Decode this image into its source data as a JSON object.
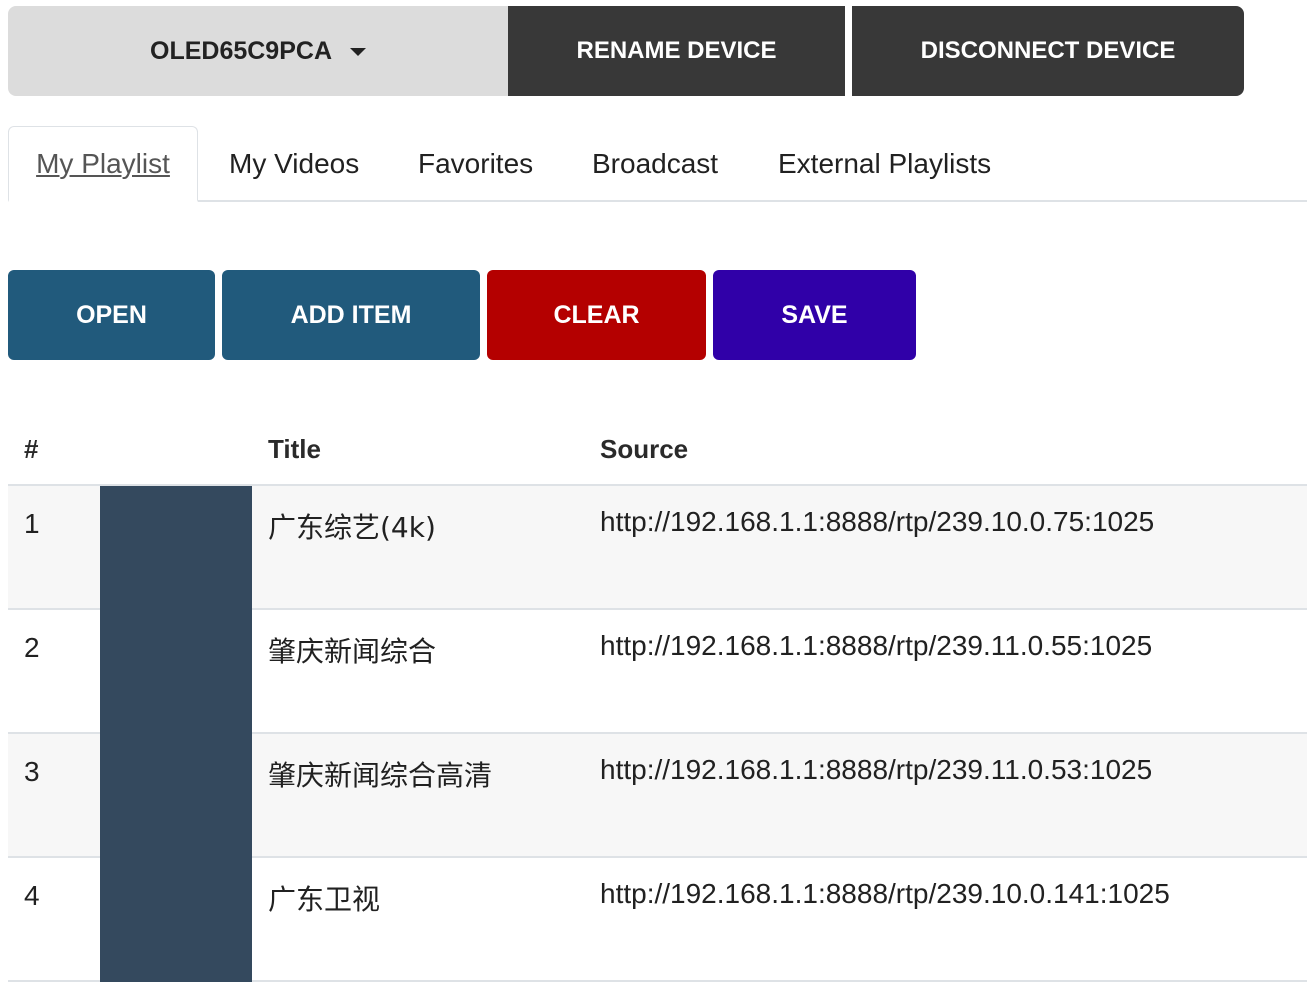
{
  "device_bar": {
    "device_name": "OLED65C9PCA",
    "rename_label": "RENAME DEVICE",
    "disconnect_label": "DISCONNECT DEVICE"
  },
  "tabs": [
    {
      "label": "My Playlist",
      "active": true
    },
    {
      "label": "My Videos",
      "active": false
    },
    {
      "label": "Favorites",
      "active": false
    },
    {
      "label": "Broadcast",
      "active": false
    },
    {
      "label": "External Playlists",
      "active": false
    }
  ],
  "actions": {
    "open_label": "OPEN",
    "add_item_label": "ADD ITEM",
    "clear_label": "CLEAR",
    "save_label": "SAVE"
  },
  "table": {
    "headers": {
      "num": "#",
      "title": "Title",
      "source": "Source"
    },
    "rows": [
      {
        "num": "1",
        "title": "广东综艺(4k)",
        "source": "http://192.168.1.1:8888/rtp/239.10.0.75:1025"
      },
      {
        "num": "2",
        "title": "肇庆新闻综合",
        "source": "http://192.168.1.1:8888/rtp/239.11.0.55:1025"
      },
      {
        "num": "3",
        "title": "肇庆新闻综合高清",
        "source": "http://192.168.1.1:8888/rtp/239.11.0.53:1025"
      },
      {
        "num": "4",
        "title": "广东卫视",
        "source": "http://192.168.1.1:8888/rtp/239.10.0.141:1025"
      }
    ]
  },
  "colors": {
    "open_add": "#215a7c",
    "clear": "#b40000",
    "save": "#3000a8",
    "device_dark": "#383838",
    "thumbnail": "#34495e"
  }
}
